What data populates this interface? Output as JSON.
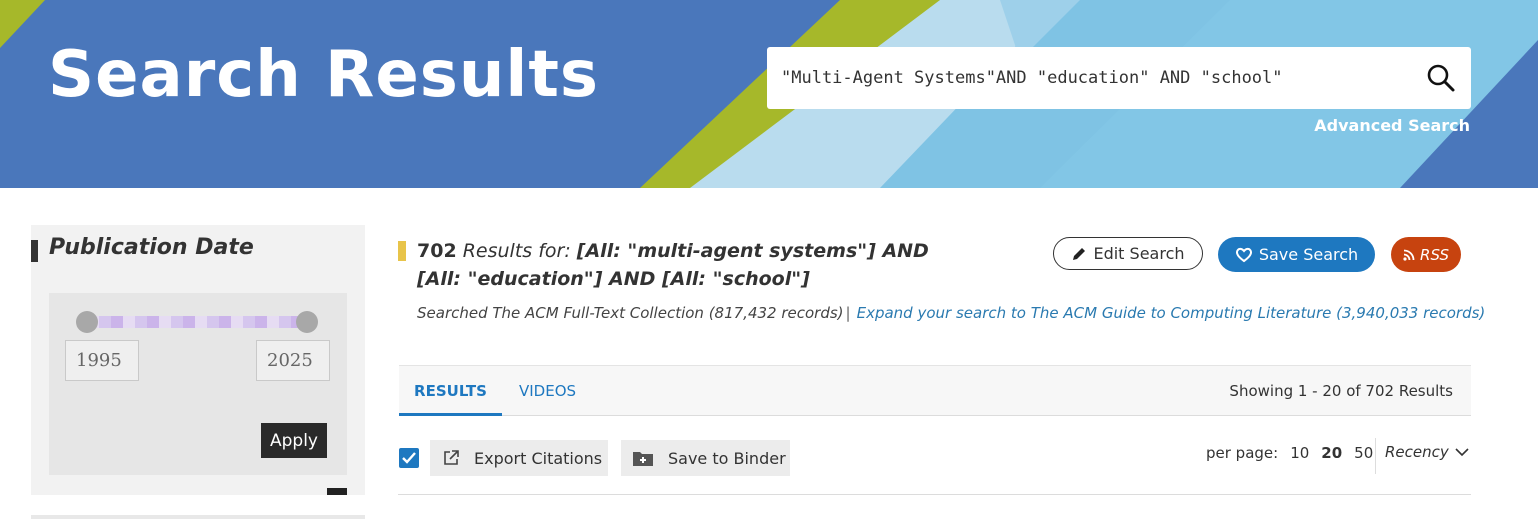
{
  "header": {
    "title": "Search Results",
    "search_value": "\"Multi-Agent Systems\"AND \"education\" AND \"school\"",
    "advanced_search_label": "Advanced Search"
  },
  "sidebar": {
    "title": "Publication Date",
    "year_from": "1995",
    "year_to": "2025",
    "apply_label": "Apply"
  },
  "results": {
    "count": "702",
    "results_for_label": "Results for:",
    "query_text": "[All: \"multi-agent systems\"] AND [All: \"education\"] AND [All: \"school\"]",
    "searched_text": "Searched The ACM Full-Text Collection (817,432 records)",
    "separator": "|",
    "expand_link": "Expand your search to The ACM Guide to Computing Literature (3,940,033 records)"
  },
  "actions": {
    "edit_search": "Edit Search",
    "save_search": "Save Search",
    "rss": "RSS"
  },
  "tabs": {
    "results": "RESULTS",
    "videos": "VIDEOS"
  },
  "showing": "Showing 1 - 20  of 702 Results",
  "toolbar": {
    "export_citations": "Export Citations",
    "save_to_binder": "Save to Binder",
    "per_page_label": "per page:",
    "per_page_options": [
      "10",
      "20",
      "50"
    ],
    "sort_label": "Recency"
  },
  "colors": {
    "banner_blue": "#4a77bb",
    "accent_green": "#a6b82a",
    "light_blue": "#7fc3e4",
    "primary_blue": "#1e78c0",
    "rss_orange": "#c7430f"
  },
  "icons": {
    "search": "search-icon",
    "edit": "pencil-icon",
    "save": "heart-icon",
    "rss": "rss-icon",
    "export": "external-link-icon",
    "binder": "folder-plus-icon",
    "sort": "chevron-down-icon",
    "checkbox": "check-icon"
  }
}
